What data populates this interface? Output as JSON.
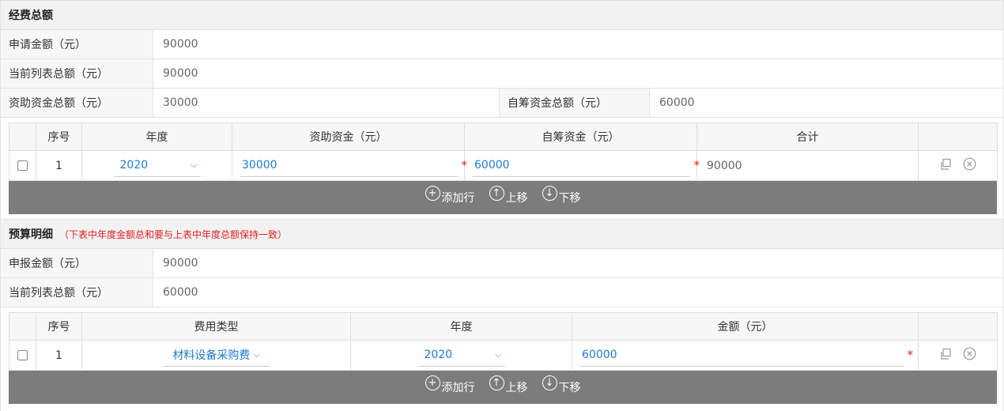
{
  "funding": {
    "title": "经费总额",
    "apply_label": "申请金额（元）",
    "apply_value": "90000",
    "list_total_label": "当前列表总额（元）",
    "list_total_value": "90000",
    "funded_label": "资助资金总额（元）",
    "funded_value": "30000",
    "self_label": "自筹资金总额（元）",
    "self_value": "60000",
    "columns": {
      "no": "序号",
      "year": "年度",
      "funded": "资助资金（元）",
      "self": "自筹资金（元）",
      "total": "合计"
    },
    "rows": [
      {
        "no": "1",
        "year": "2020",
        "funded": "30000",
        "self": "60000",
        "total": "90000"
      }
    ]
  },
  "budget": {
    "title": "预算明细",
    "note": "（下表中年度金额总和要与上表中年度总额保持一致）",
    "report_label": "申报金额（元）",
    "report_value": "90000",
    "list_total_label": "当前列表总额（元）",
    "list_total_value": "60000",
    "columns": {
      "no": "序号",
      "type": "费用类型",
      "year": "年度",
      "amount": "金额（元）"
    },
    "rows": [
      {
        "no": "1",
        "type": "材料设备采购费",
        "year": "2020",
        "amount": "60000"
      }
    ]
  },
  "toolbar": {
    "add": "添加行",
    "up": "上移",
    "down": "下移"
  },
  "icons": {
    "copy": "copy-icon",
    "remove": "remove-circle-icon",
    "chevron": "chevron-down-icon"
  },
  "colors": {
    "accent": "#1f7bd0",
    "required": "#e02020",
    "toolbar": "#7c7c7c"
  }
}
